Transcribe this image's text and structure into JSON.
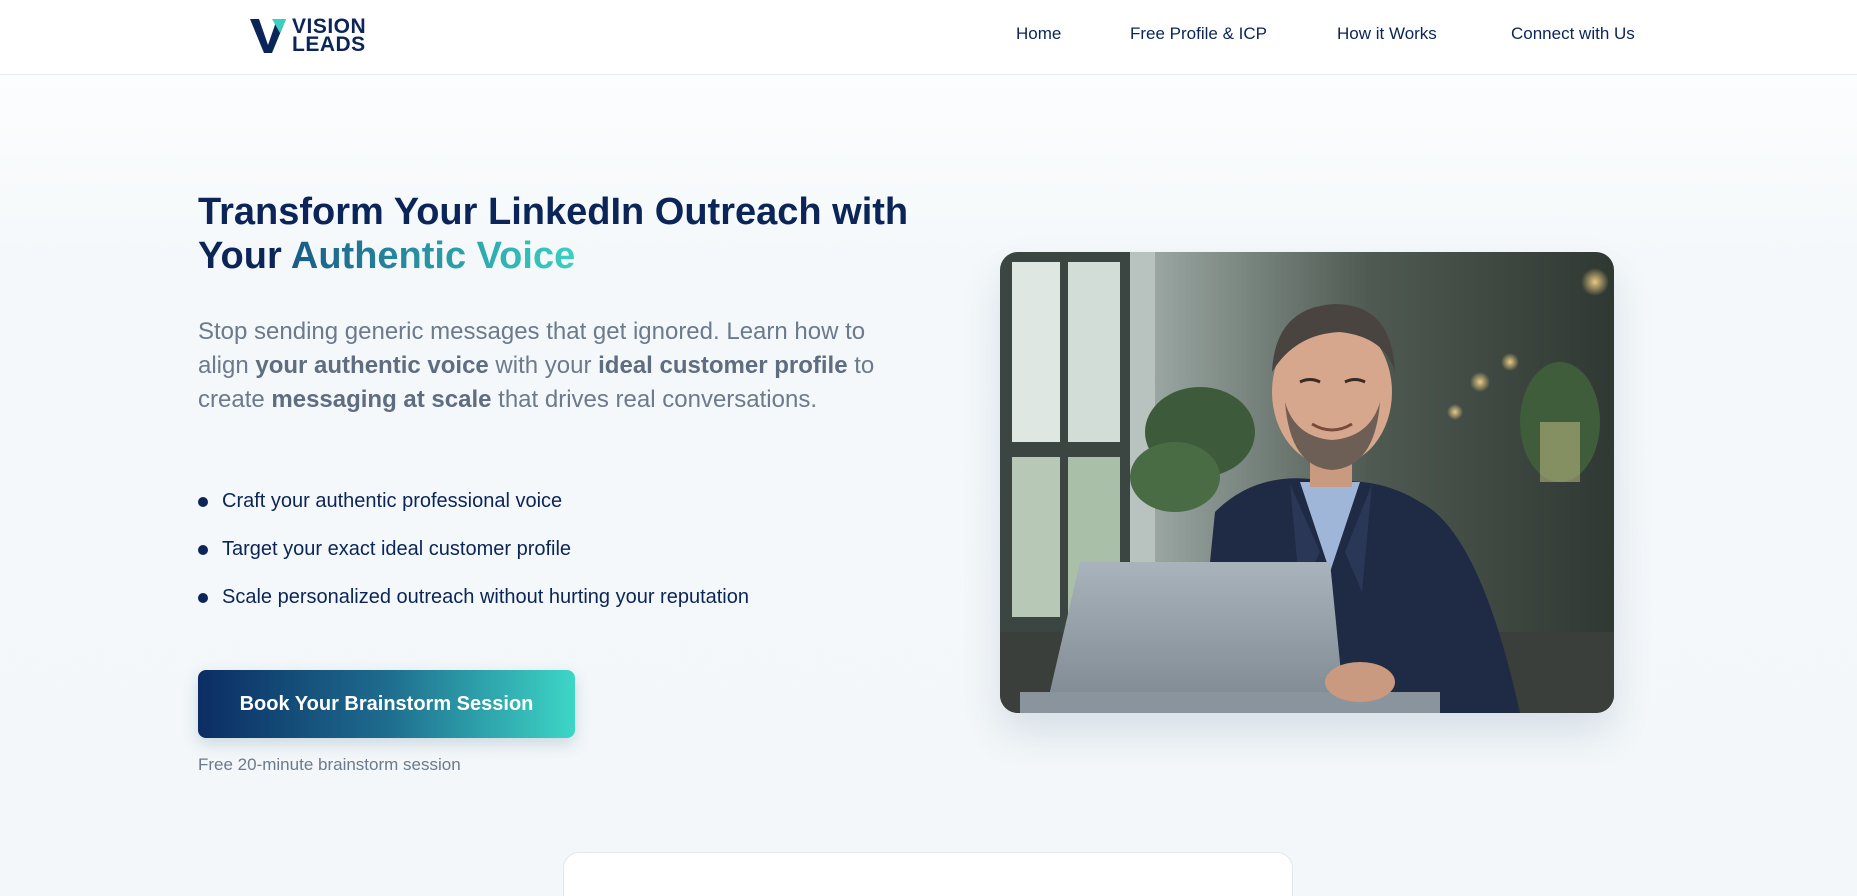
{
  "brand": {
    "logo_line1": "VISION",
    "logo_line2": "LEADS",
    "colors": {
      "navy": "#0b2559",
      "teal": "#39d0c2",
      "muted": "#6b7a8c"
    }
  },
  "nav": {
    "items": [
      {
        "label": "Home"
      },
      {
        "label": "Free Profile & ICP"
      },
      {
        "label": "How it Works"
      },
      {
        "label": "Connect with Us"
      }
    ]
  },
  "hero": {
    "title_part1": "Transform Your LinkedIn Outreach with",
    "title_part2": "Your ",
    "title_accent": "Authentic Voice",
    "subtitle": {
      "t1": "Stop sending generic messages that get ignored. Learn how to align ",
      "b1": "your authentic voice",
      "t2": " with your ",
      "b2": "ideal customer profile",
      "t3": " to create ",
      "b3": "messaging at scale",
      "t4": " that drives real conversations."
    },
    "bullets": [
      "Craft your authentic professional voice",
      "Target your exact ideal customer profile",
      "Scale personalized outreach without hurting your reputation"
    ],
    "cta_label": "Book Your Brainstorm Session",
    "cta_note": "Free 20-minute brainstorm session",
    "image_subject": "smiling-businessman-at-laptop"
  }
}
